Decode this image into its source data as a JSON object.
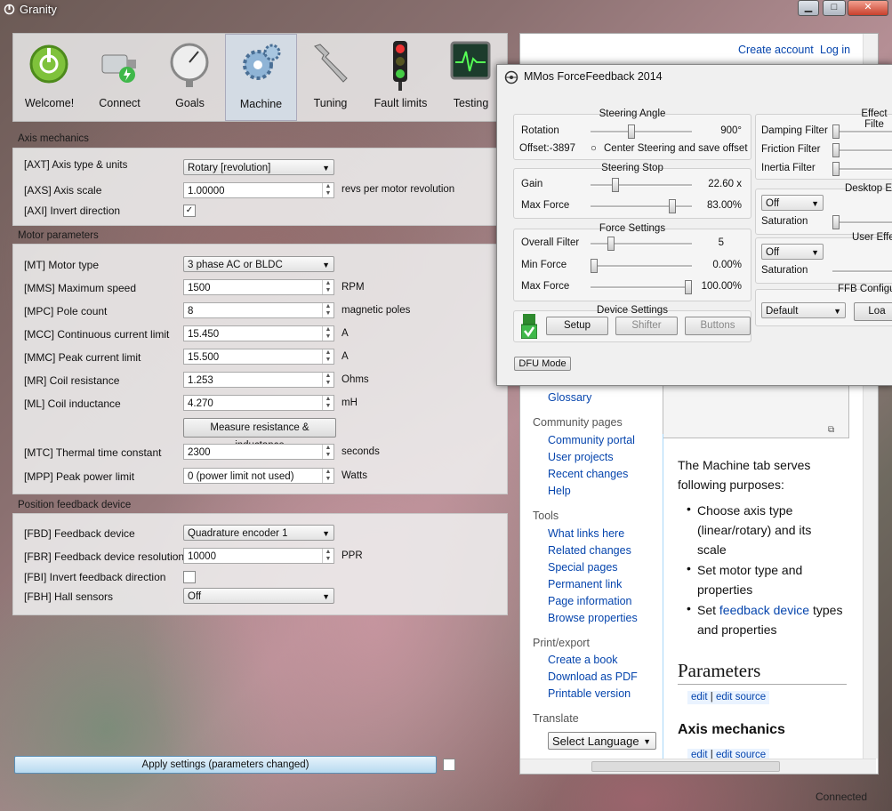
{
  "app": {
    "title": "Granity"
  },
  "toolbar": [
    {
      "label": "Welcome!",
      "icon": "power-icon"
    },
    {
      "label": "Connect",
      "icon": "connector-icon"
    },
    {
      "label": "Goals",
      "icon": "gauge-icon"
    },
    {
      "label": "Machine",
      "icon": "gears-icon",
      "selected": true
    },
    {
      "label": "Tuning",
      "icon": "wrench-icon"
    },
    {
      "label": "Fault limits",
      "icon": "traffic-light-icon"
    },
    {
      "label": "Testing",
      "icon": "oscilloscope-icon"
    }
  ],
  "axis": {
    "header": "Axis mechanics",
    "type_label": "[AXT] Axis type & units",
    "type_value": "Rotary [revolution]",
    "scale_label": "[AXS] Axis scale",
    "scale_value": "1.00000",
    "scale_unit": "revs per motor revolution",
    "invert_label": "[AXI] Invert direction",
    "invert_mark": "✓"
  },
  "motor": {
    "header": "Motor parameters",
    "type_label": "[MT] Motor type",
    "type_value": "3 phase AC or BLDC",
    "rows": [
      {
        "label": "[MMS] Maximum speed",
        "value": "1500",
        "unit": "RPM"
      },
      {
        "label": "[MPC] Pole count",
        "value": "8",
        "unit": "magnetic poles"
      },
      {
        "label": "[MCC] Continuous current limit",
        "value": "15.450",
        "unit": "A"
      },
      {
        "label": "[MMC] Peak current limit",
        "value": "15.500",
        "unit": "A"
      },
      {
        "label": "[MR] Coil resistance",
        "value": "1.253",
        "unit": "Ohms"
      },
      {
        "label": "[ML] Coil inductance",
        "value": "4.270",
        "unit": "mH"
      }
    ],
    "measure_button": "Measure resistance & inductance",
    "mtc_label": "[MTC] Thermal time constant",
    "mtc_value": "2300",
    "mtc_unit": "seconds",
    "mpp_label": "[MPP] Peak power limit",
    "mpp_value": "0 (power limit not used)",
    "mpp_unit": "Watts"
  },
  "feedback": {
    "header": "Position feedback device",
    "fbd_label": "[FBD] Feedback device",
    "fbd_value": "Quadrature encoder 1",
    "fbr_label": "[FBR] Feedback device resolution",
    "fbr_value": "10000",
    "fbr_unit": "PPR",
    "fbi_label": "[FBI] Invert feedback direction",
    "fbh_label": "[FBH] Hall sensors",
    "fbh_value": "Off"
  },
  "apply_button": "Apply settings (parameters changed)",
  "status": "Connected",
  "wiki": {
    "create_account": "Create account",
    "log_in": "Log in",
    "glossary": "Glossary",
    "community_header": "Community pages",
    "community_links": [
      "Community portal",
      "User projects",
      "Recent changes",
      "Help"
    ],
    "tools_header": "Tools",
    "tools_links": [
      "What links here",
      "Related changes",
      "Special pages",
      "Permanent link",
      "Page information",
      "Browse properties"
    ],
    "print_header": "Print/export",
    "print_links": [
      "Create a book",
      "Download as PDF",
      "Printable version"
    ],
    "translate_header": "Translate",
    "select_language": "Select Language",
    "intro_1": "The Machine tab serves",
    "intro_2": "following purposes:",
    "bullets": [
      {
        "a": "Choose axis type",
        "b": "(linear/rotary) and its",
        "c": "scale"
      },
      {
        "a": "Set motor type and",
        "b": "properties"
      },
      {
        "pre": "Set ",
        "link": "feedback device",
        "post": " types",
        "b": "and properties"
      }
    ],
    "h_parameters": "Parameters",
    "edit": "edit",
    "sep": "|",
    "edit_source": "edit source",
    "h_axis": "Axis mechanics"
  },
  "mmos": {
    "title": "MMos ForceFeedback 2014",
    "steering_angle": "Steering Angle",
    "rotation_label": "Rotation",
    "rotation_value": "900°",
    "rotation_level": 0.4,
    "offset_label": "Offset:-3897",
    "center_label": "Center Steering and save offset",
    "steering_stop": "Steering Stop",
    "gain_label": "Gain",
    "gain_value": "22.60 x",
    "gain_level": 0.23,
    "maxforce_label": "Max Force",
    "maxforce_value": "83.00%",
    "maxforce_level": 0.83,
    "force_settings": "Force Settings",
    "overall_label": "Overall Filter",
    "overall_value": "5",
    "overall_level": 0.18,
    "minforce_label": "Min Force",
    "minforce_value": "0.00%",
    "minforce_level": 0.0,
    "maxforce2_label": "Max Force",
    "maxforce2_value": "100.00%",
    "maxforce2_level": 1.0,
    "device_settings": "Device Settings",
    "setup": "Setup",
    "shifter": "Shifter",
    "buttons": "Buttons",
    "dfu": "DFU Mode",
    "effect_filters": "Effect Filte",
    "damping": "Damping Filter",
    "friction": "Friction Filter",
    "inertia": "Inertia Filter",
    "desktop_effects": "Desktop Ef",
    "off1": "Off",
    "saturation1": "Saturation",
    "user_effects": "User Effe",
    "off2": "Off",
    "saturation2": "Saturation",
    "ffb_config": "FFB Configu",
    "default": "Default",
    "load": "Loa"
  }
}
